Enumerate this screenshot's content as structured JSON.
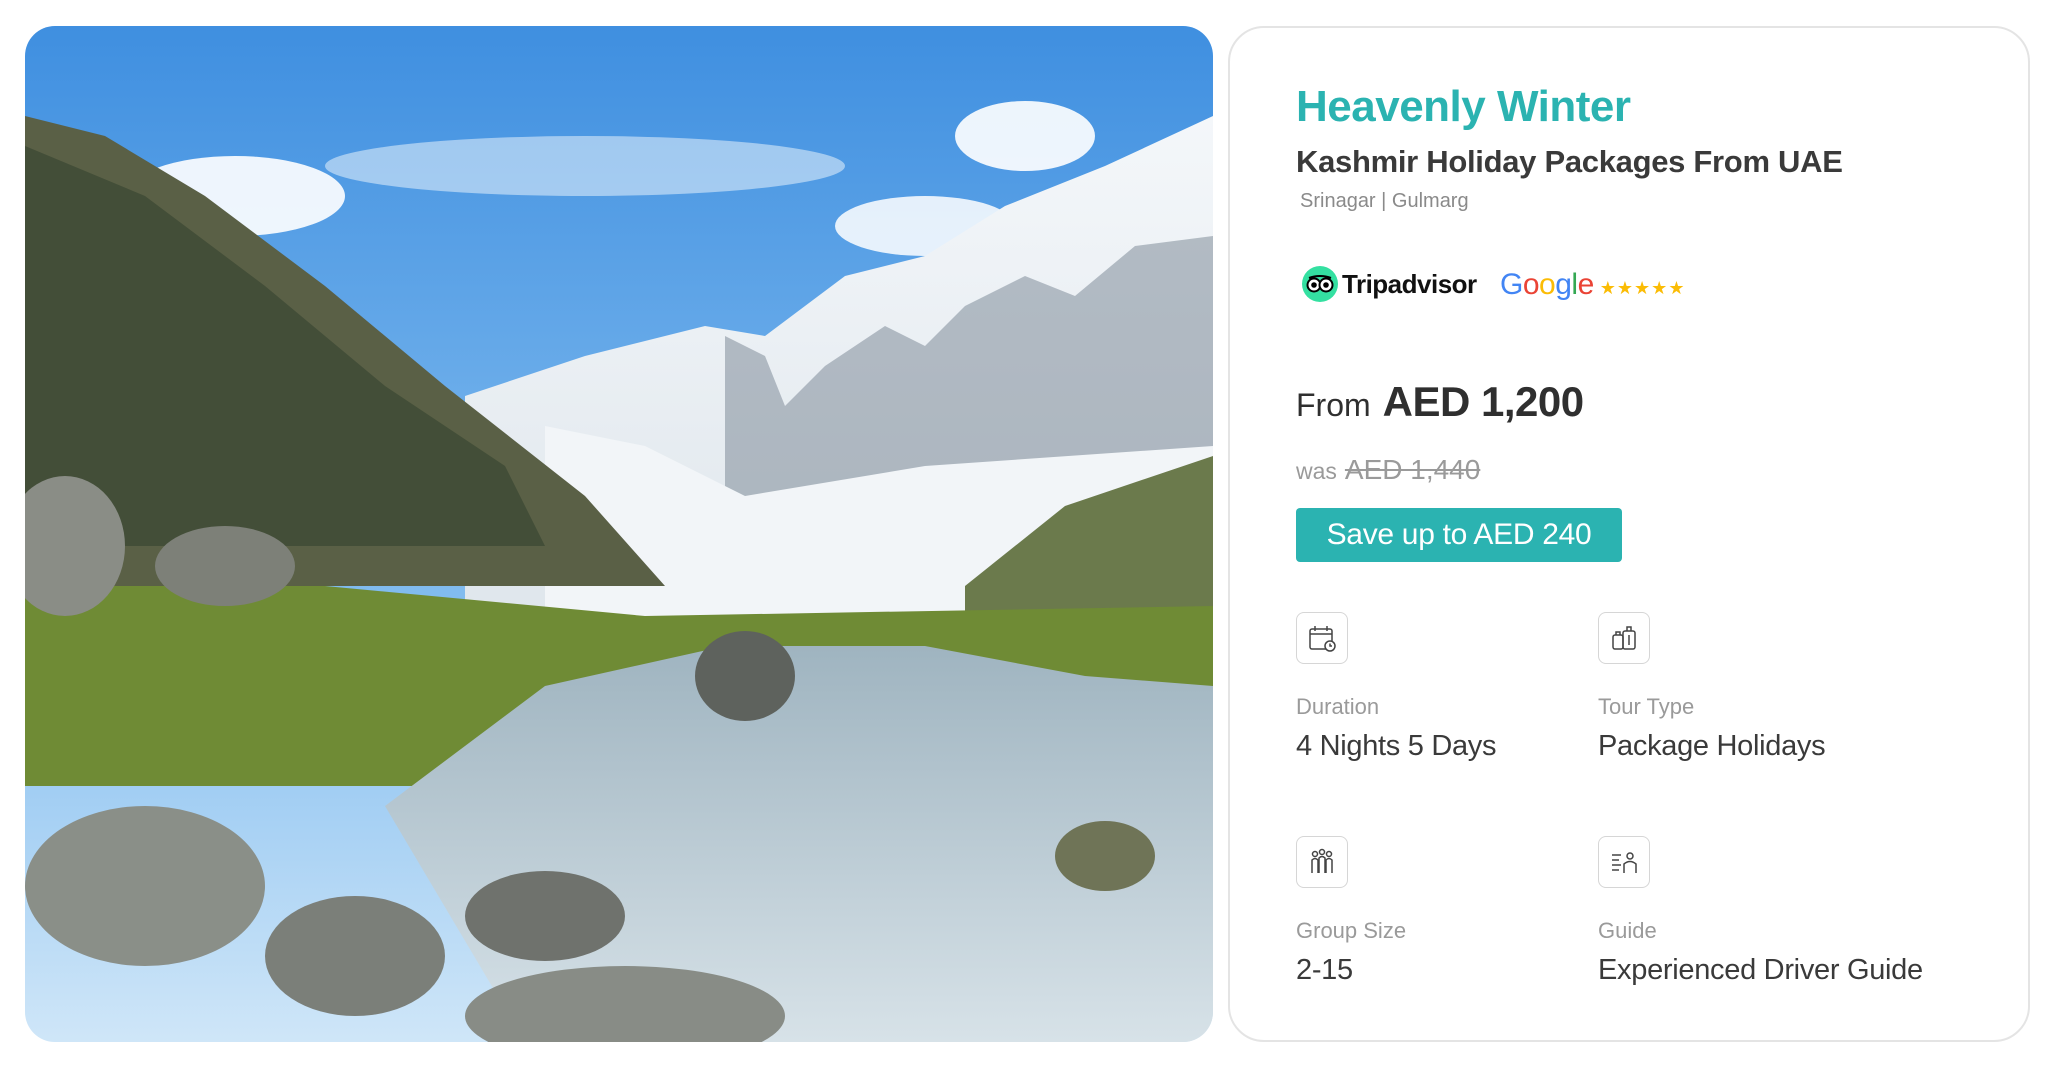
{
  "package": {
    "title": "Heavenly Winter",
    "subtitle": "Kashmir Holiday Packages From UAE",
    "locations": "Srinagar | Gulmarg"
  },
  "ratings": {
    "tripadvisor_label": "Tripadvisor",
    "google_label": [
      "G",
      "o",
      "o",
      "g",
      "l",
      "e"
    ],
    "google_stars": "★★★★★"
  },
  "pricing": {
    "from_label": "From",
    "price": "AED 1,200",
    "was_label": "was",
    "old_price": "AED 1,440",
    "save_label": "Save up to AED 240"
  },
  "features": [
    {
      "icon": "calendar-icon",
      "label": "Duration",
      "value": "4 Nights 5 Days"
    },
    {
      "icon": "luggage-icon",
      "label": "Tour Type",
      "value": "Package Holidays"
    },
    {
      "icon": "group-icon",
      "label": "Group Size",
      "value": "2-15"
    },
    {
      "icon": "driver-guide-icon",
      "label": "Guide",
      "value": "Experienced Driver Guide"
    }
  ],
  "colors": {
    "accent": "#2bb3b1",
    "text_dark": "#3a3a3a",
    "text_muted": "#9a9a9a"
  }
}
